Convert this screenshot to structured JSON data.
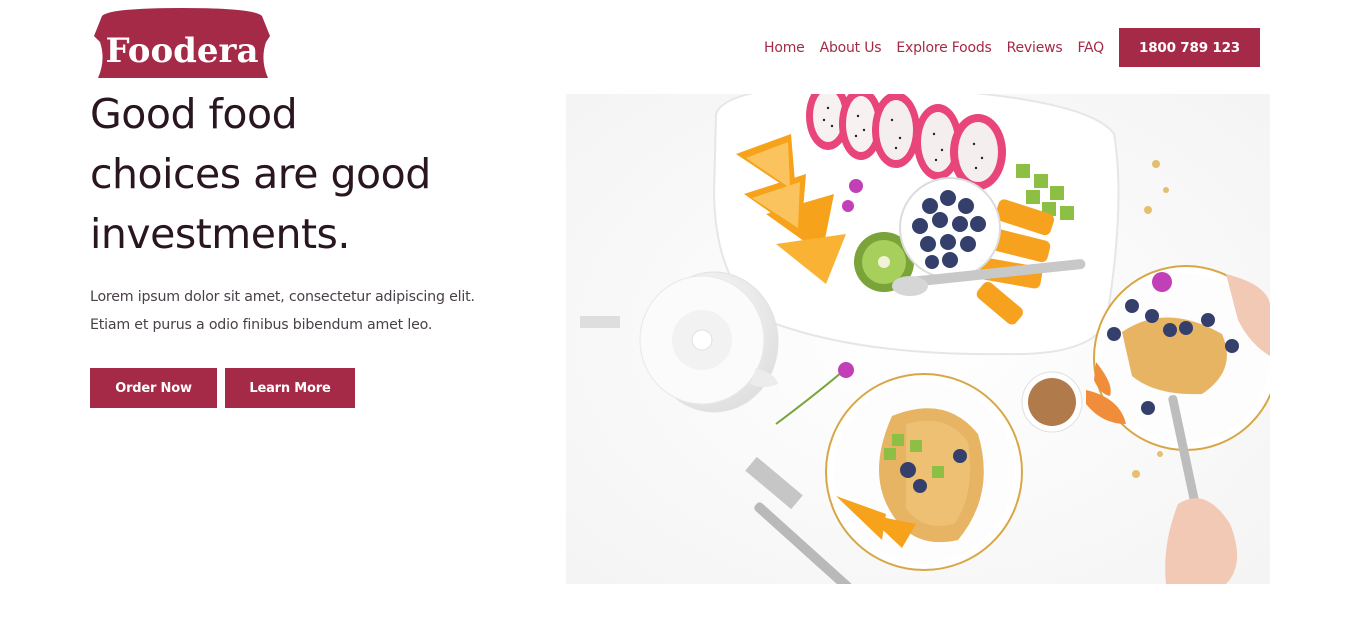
{
  "brand": {
    "name": "Foodera",
    "color": "#a52a47"
  },
  "nav": {
    "items": [
      {
        "label": "Home"
      },
      {
        "label": "About Us"
      },
      {
        "label": "Explore Foods"
      },
      {
        "label": "Reviews"
      },
      {
        "label": "FAQ"
      }
    ],
    "phone": "1800 789 123"
  },
  "hero": {
    "headline_lines": [
      "Good food",
      "choices are good",
      "investments."
    ],
    "subtitle_lines": [
      "Lorem ipsum dolor sit amet, consectetur adipiscing elit.",
      "Etiam et purus a odio finibus bibendum amet leo."
    ],
    "order_label": "Order Now",
    "learn_label": "Learn More"
  },
  "colors": {
    "accent": "#a52a47",
    "heading": "#2a1620",
    "body_text": "#4a4048"
  }
}
